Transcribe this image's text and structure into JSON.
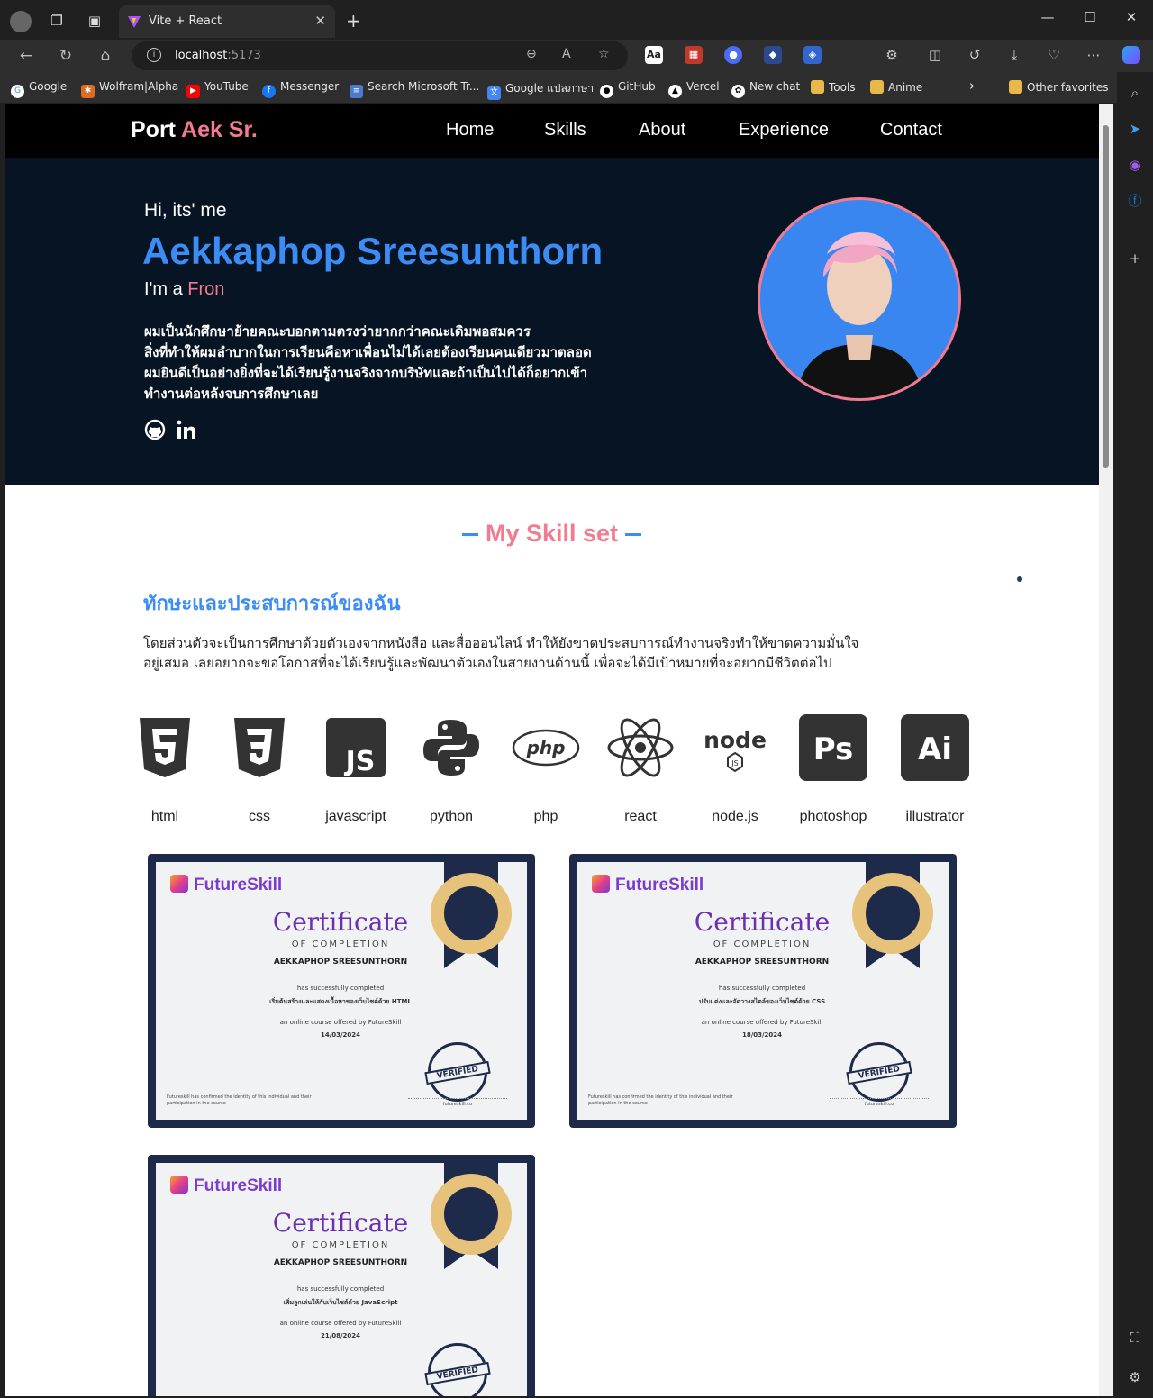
{
  "browser": {
    "tab_title": "Vite + React",
    "url_host": "localhost",
    "url_port": ":5173",
    "bookmarks": [
      "Google",
      "Wolfram|Alpha",
      "YouTube",
      "Messenger",
      "Search Microsoft Tr...",
      "Google แปลภาษา",
      "GitHub",
      "Vercel",
      "New chat",
      "Tools",
      "Anime"
    ],
    "other_favorites": "Other favorites"
  },
  "site": {
    "logo_main": "Port ",
    "logo_accent": "Aek Sr.",
    "nav": [
      "Home",
      "Skills",
      "About",
      "Experience",
      "Contact"
    ],
    "hero": {
      "greeting": "Hi, its' me",
      "name": "Aekkaphop Sreesunthorn",
      "im_prefix": "I'm a ",
      "im_role": "Fron",
      "bio": [
        "ผมเป็นนักศึกษาย้ายคณะบอกตามตรงว่ายากกว่าคณะเดิมพอสมควร",
        "สิ่งที่ทำให้ผมลำบากในการเรียนคือหาเพื่อนไม่ได้เลยต้องเรียนคนเดียวมาตลอด",
        "ผมยินดีเป็นอย่างยิ่งที่จะได้เรียนรู้งานจริงจากบริษัทและถ้าเป็นไปได้ก็อยากเข้า",
        "ทำงานต่อหลังจบการศึกษาเลย"
      ]
    },
    "skills": {
      "section_title": "My Skill set",
      "heading": "ทักษะและประสบการณ์ของฉัน",
      "description": [
        "โดยส่วนตัวจะเป็นการศึกษาด้วยตัวเองจากหนังสือ และสื่อออนไลน์ ทำให้ยังขาดประสบการณ์ทำงานจริงทำให้ขาดความมั่นใจ",
        "อยู่เสมอ เลยอยากจะขอโอกาสที่จะได้เรียนรู้และพัฒนาตัวเองในสายงานด้านนี้ เพื่อจะได้มีเป้าหมายที่จะอยากมีชีวิตต่อไป"
      ],
      "items": [
        "html",
        "css",
        "javascript",
        "python",
        "php",
        "react",
        "node.js",
        "photoshop",
        "illustrator"
      ]
    },
    "certificates": [
      {
        "brand": "FutureSkill",
        "title": "Certificate",
        "subtitle": "OF COMPLETION",
        "name": "AEKKAPHOP SREESUNTHORN",
        "line1": "has successfully completed",
        "course": "เริ่มต้นสร้างและแสดงเนื้อหาของเว็บไซต์ด้วย HTML",
        "line2": "an online course offered by FutureSkill",
        "date": "14/03/2024",
        "stamp": "VERIFIED",
        "footer": "Futureskill has confirmed the identity of this individual and their participation in the course",
        "sig": "futureskill.co"
      },
      {
        "brand": "FutureSkill",
        "title": "Certificate",
        "subtitle": "OF COMPLETION",
        "name": "AEKKAPHOP SREESUNTHORN",
        "line1": "has successfully completed",
        "course": "ปรับแต่งและจัดวางสไตล์ของเว็บไซต์ด้วย CSS",
        "line2": "an online course offered by FutureSkill",
        "date": "18/03/2024",
        "stamp": "VERIFIED",
        "footer": "Futureskill has confirmed the identity of this individual and their participation in the course",
        "sig": "futureskill.co"
      },
      {
        "brand": "FutureSkill",
        "title": "Certificate",
        "subtitle": "OF COMPLETION",
        "name": "AEKKAPHOP SREESUNTHORN",
        "line1": "has successfully completed",
        "course": "เพิ่มลูกเล่นให้กับเว็บไซต์ด้วย JavaScript",
        "line2": "an online course offered by FutureSkill",
        "date": "21/08/2024",
        "stamp": "VERIFIED",
        "footer": "",
        "sig": ""
      }
    ]
  },
  "colors": {
    "accent_pink": "#f27b8f",
    "accent_blue": "#3b8cf5",
    "hero_bg": "#061424"
  }
}
